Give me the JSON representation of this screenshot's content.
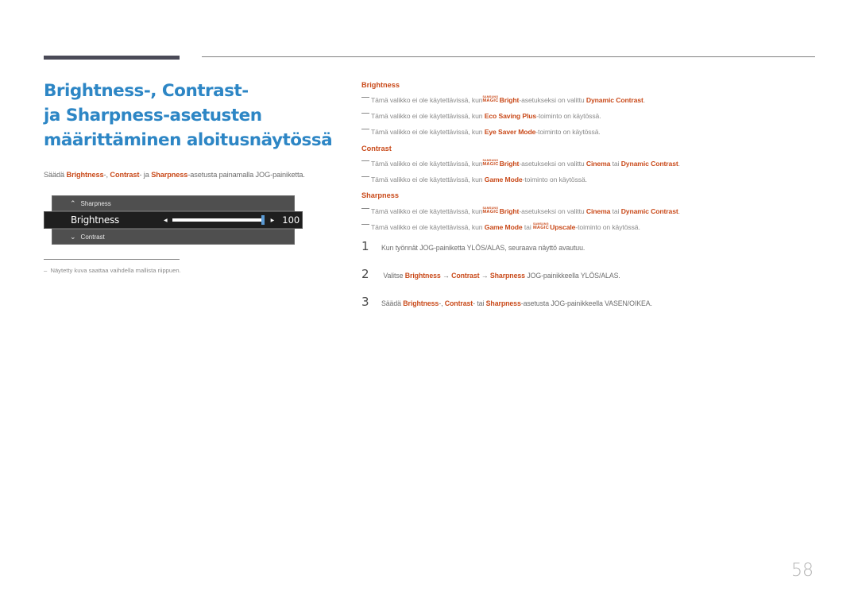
{
  "page": {
    "title_lines": [
      "Brightness-, Contrast-",
      "ja Sharpness-asetusten",
      "määrittäminen aloitusnäytössä"
    ],
    "page_number": "58",
    "colors": {
      "title": "#2d86c5",
      "highlight": "#c94a1a",
      "body": "#6d6d6d"
    }
  },
  "intro": {
    "prefix": "Säädä ",
    "b1": "Brightness",
    "t1": "-, ",
    "b2": "Contrast",
    "t2": "- ja ",
    "b3": "Sharpness",
    "t3": "-asetusta painamalla JOG-painiketta."
  },
  "osd": {
    "up_item": "Sharpness",
    "up_icon": "chevron-up-icon",
    "current_item": "Brightness",
    "value": "100",
    "slider_fraction": 1.0,
    "down_item": "Contrast",
    "down_icon": "chevron-down-icon"
  },
  "footnote": {
    "dash": "–",
    "text": "Näytetty kuva saattaa vaihdella mallista riippuen."
  },
  "magic_logo": {
    "top": "SAMSUNG",
    "bottom": "MAGIC"
  },
  "sections": {
    "brightness": {
      "heading": "Brightness",
      "notes": [
        {
          "pre": "Tämä valikko ei ole käytettävissä, kun ",
          "magic": true,
          "b1": "Bright",
          "mid": "-asetukseksi on valittu ",
          "b2": "Dynamic Contrast",
          "post": "."
        },
        {
          "pre": "Tämä valikko ei ole käytettävissä, kun ",
          "b1": "Eco Saving Plus",
          "post": "-toiminto on käytössä."
        },
        {
          "pre": "Tämä valikko ei ole käytettävissä, kun ",
          "b1": "Eye Saver Mode",
          "post": "-toiminto on käytössä."
        }
      ]
    },
    "contrast": {
      "heading": "Contrast",
      "notes": [
        {
          "pre": "Tämä valikko ei ole käytettävissä, kun ",
          "magic": true,
          "b1": "Bright",
          "mid": " -asetukseksi on valittu ",
          "b2": "Cinema",
          "mid2": " tai ",
          "b3": "Dynamic Contrast",
          "post": "."
        },
        {
          "pre": "Tämä valikko ei ole käytettävissä, kun ",
          "b1": "Game Mode",
          "post": "-toiminto on käytössä."
        }
      ]
    },
    "sharpness": {
      "heading": "Sharpness",
      "notes": [
        {
          "pre": "Tämä valikko ei ole käytettävissä, kun ",
          "magic": true,
          "b1": "Bright",
          "mid": " -asetukseksi on valittu ",
          "b2": "Cinema",
          "mid2": " tai ",
          "b3": "Dynamic Contrast",
          "post": "."
        },
        {
          "pre": "Tämä valikko ei ole käytettävissä, kun ",
          "b1": "Game Mode",
          "mid": " tai ",
          "b2": "Upscale",
          "post": "-toiminto on käytössä."
        }
      ]
    }
  },
  "steps": [
    {
      "num": "1",
      "text": "Kun työnnät JOG-painiketta YLÖS/ALAS, seuraava näyttö avautuu."
    },
    {
      "num": "2",
      "pre": "Valitse ",
      "b1": "Brightness",
      "arrow1": " → ",
      "b2": "Contrast",
      "arrow2": " → ",
      "b3": "Sharpness",
      "post": " JOG-painikkeella YLÖS/ALAS."
    },
    {
      "num": "3",
      "pre": "Säädä ",
      "b1": "Brightness",
      "t1": "-, ",
      "b2": "Contrast",
      "t2": "- tai ",
      "b3": "Sharpness",
      "post": "-asetusta JOG-painikkeella VASEN/OIKEA."
    }
  ]
}
